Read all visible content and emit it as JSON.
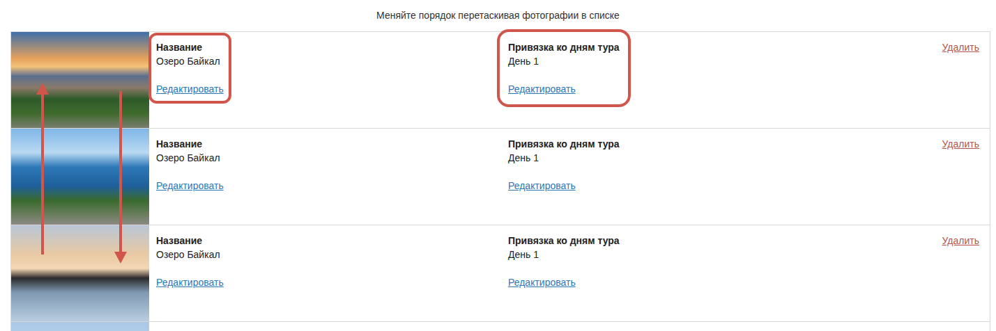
{
  "hint": "Меняйте порядок перетаскивая фотографии в списке",
  "drag_arrows_shown": true,
  "rows": [
    {
      "kind": "full",
      "highlighted": true,
      "title_label": "Название",
      "title": "Озеро Байкал",
      "title_edit": "Редактировать",
      "days_label": "Привязка ко дням тура",
      "days": "День 1",
      "days_edit": "Редактировать",
      "delete": "Удалить"
    },
    {
      "kind": "full",
      "highlighted": false,
      "title_label": "Название",
      "title": "Озеро Байкал",
      "title_edit": "Редактировать",
      "days_label": "Привязка ко дням тура",
      "days": "День 1",
      "days_edit": "Редактировать",
      "delete": "Удалить"
    },
    {
      "kind": "full",
      "highlighted": false,
      "title_label": "Название",
      "title": "Озеро Байкал",
      "title_edit": "Редактировать",
      "days_label": "Привязка ко дням тура",
      "days": "День 1",
      "days_edit": "Редактировать",
      "delete": "Удалить"
    },
    {
      "kind": "cut",
      "highlighted": false
    }
  ]
}
